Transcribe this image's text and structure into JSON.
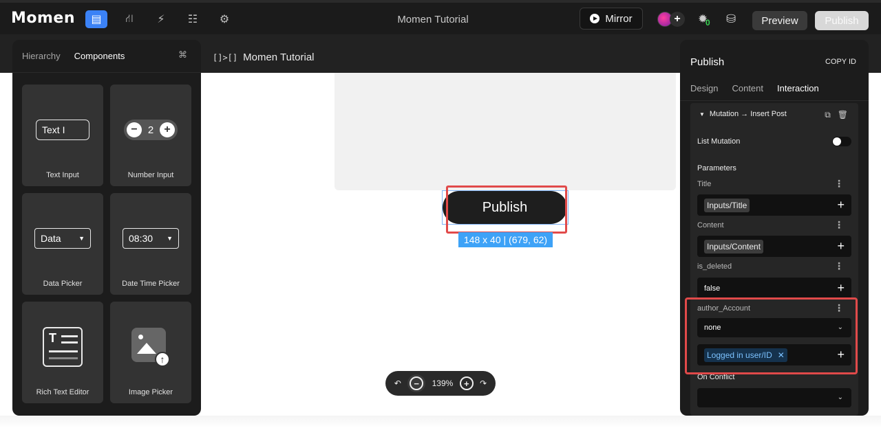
{
  "app": {
    "logo": "Momen",
    "project_title": "Momen Tutorial"
  },
  "topbar": {
    "mirror_label": "Mirror",
    "bug_count": "0",
    "preview_label": "Preview",
    "publish_label": "Publish"
  },
  "breadcrumb": {
    "icon_text": "[]>[]",
    "page_name": "Momen Tutorial"
  },
  "canvas": {
    "button_label": "Publish",
    "selection_dims": "148 x 40 | (679, 62)",
    "zoom_level": "139%"
  },
  "left_panel": {
    "tabs": [
      "Hierarchy",
      "Components"
    ],
    "active_tab": "Components",
    "components": [
      {
        "label": "Text Input",
        "preview": "Text"
      },
      {
        "label": "Number Input",
        "preview": "2"
      },
      {
        "label": "Data Picker",
        "preview": "Data"
      },
      {
        "label": "Date Time Picker",
        "preview": "08:30"
      },
      {
        "label": "Rich Text Editor",
        "preview": "T"
      },
      {
        "label": "Image Picker",
        "preview": ""
      }
    ]
  },
  "right_panel": {
    "title": "Publish",
    "copy_id": "COPY ID",
    "tabs": [
      "Design",
      "Content",
      "Interaction"
    ],
    "active_tab": "Interaction",
    "mutation_title": "Mutation → Insert Post",
    "list_mutation_label": "List Mutation",
    "list_mutation_on": false,
    "parameters_label": "Parameters",
    "params": [
      {
        "name": "Title",
        "value": "Inputs/Title"
      },
      {
        "name": "Content",
        "value": "Inputs/Content"
      },
      {
        "name": "is_deleted",
        "value": "false"
      },
      {
        "name": "author_Account",
        "select": "none",
        "value": "Logged in user/ID"
      }
    ],
    "on_conflict_label": "On Conflict"
  }
}
